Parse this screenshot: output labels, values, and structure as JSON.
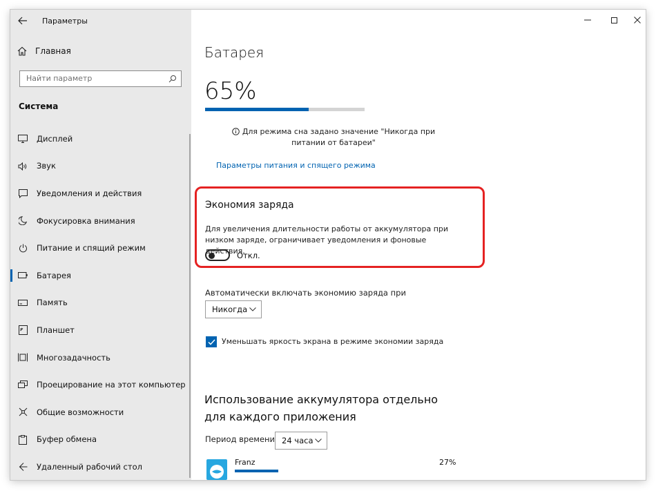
{
  "window": {
    "title": "Параметры"
  },
  "sidebar": {
    "home_label": "Главная",
    "search_placeholder": "Найти параметр",
    "section_label": "Система",
    "items": [
      {
        "label": "Дисплей",
        "icon": "display-icon"
      },
      {
        "label": "Звук",
        "icon": "speaker-icon"
      },
      {
        "label": "Уведомления и действия",
        "icon": "notification-icon"
      },
      {
        "label": "Фокусировка внимания",
        "icon": "moon-icon"
      },
      {
        "label": "Питание и спящий режим",
        "icon": "power-icon"
      },
      {
        "label": "Батарея",
        "icon": "battery-icon",
        "active": true
      },
      {
        "label": "Память",
        "icon": "storage-icon"
      },
      {
        "label": "Планшет",
        "icon": "tablet-icon"
      },
      {
        "label": "Многозадачность",
        "icon": "multitasking-icon"
      },
      {
        "label": "Проецирование на этот компьютер",
        "icon": "projection-icon"
      },
      {
        "label": "Общие возможности",
        "icon": "shared-experiences-icon"
      },
      {
        "label": "Буфер обмена",
        "icon": "clipboard-icon"
      },
      {
        "label": "Удаленный рабочий стол",
        "icon": "remote-desktop-icon"
      }
    ]
  },
  "main": {
    "title": "Батарея",
    "battery_percent_text": "65%",
    "battery_level": 0.65,
    "info_text": "Для режима сна задано значение \"Никогда при питании от батареи\"",
    "power_link": "Параметры питания и спящего режима",
    "saver": {
      "title": "Экономия заряда",
      "description": "Для увеличения длительности работы от аккумулятора при низком заряде, ограничивает уведомления и фоновые действия.",
      "toggle_label": "Откл.",
      "toggle_on": false
    },
    "auto": {
      "label": "Автоматически включать экономию заряда при",
      "selected": "Никогда"
    },
    "brightness": {
      "label": "Уменьшать яркость экрана в режиме экономии заряда",
      "checked": true
    },
    "usage": {
      "heading": "Использование аккумулятора отдельно для каждого приложения",
      "period_label": "Период времени:",
      "period_selected": "24 часа",
      "apps": [
        {
          "name": "Franz",
          "percent": "27%"
        }
      ]
    }
  },
  "colors": {
    "accent": "#0063b1",
    "highlight": "#e52222",
    "sidebar_bg": "#e9e9e9"
  }
}
